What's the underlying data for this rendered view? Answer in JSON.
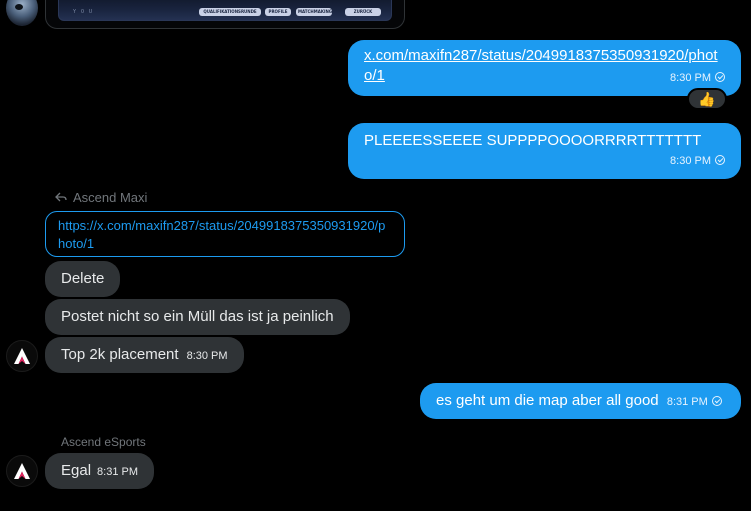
{
  "top_card": {
    "tiny_text": "Y O U",
    "chips": [
      "QUALIFIKATIONSRUNDE",
      "PROFILE",
      "MATCHMAKING",
      "ZURÜCK"
    ]
  },
  "messages": {
    "m1": {
      "link": "x.com/maxifn287/status/2049918375350931920/photo/1",
      "time": "8:30 PM",
      "reaction": "👍"
    },
    "m2": {
      "text": "PLEEEESSEEEE SUPPPPOOOORRRRTTTTTTT",
      "time": "8:30 PM"
    },
    "reply": {
      "label": "Ascend Maxi"
    },
    "quote": {
      "link": "https://x.com/maxifn287/status/2049918375350931920/photo/1"
    },
    "m3": {
      "text": "Delete"
    },
    "m4": {
      "text": "Postet nicht so ein Müll das ist ja peinlich"
    },
    "m5": {
      "text": "Top 2k placement",
      "time": "8:30 PM"
    },
    "m6": {
      "text": "es geht um die map aber all good",
      "time": "8:31 PM"
    },
    "sender2": {
      "name": "Ascend eSports"
    },
    "m7": {
      "text": "Egal",
      "time": "8:31 PM"
    }
  },
  "colors": {
    "outgoing": "#1d9bf0",
    "incoming": "#2f3336",
    "background": "#000000"
  }
}
